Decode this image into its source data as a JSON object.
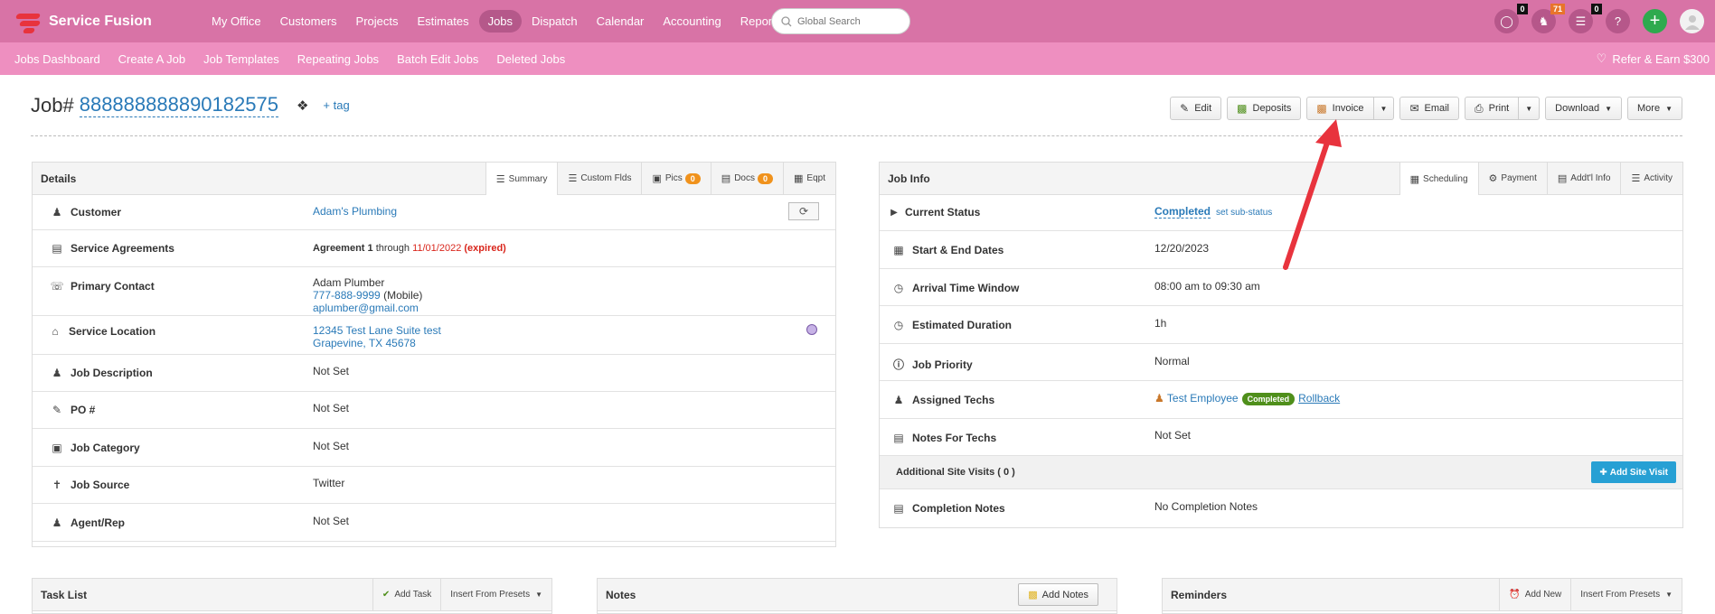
{
  "brand": {
    "name": "Service Fusion"
  },
  "main_menu": [
    "My Office",
    "Customers",
    "Projects",
    "Estimates",
    "Jobs",
    "Dispatch",
    "Calendar",
    "Accounting",
    "Reports"
  ],
  "search": {
    "placeholder": "Global Search"
  },
  "top_icons": {
    "chat_badge": "0",
    "notify_badge": "71",
    "tasks_badge": "0"
  },
  "sub_menu": [
    "Jobs Dashboard",
    "Create A Job",
    "Job Templates",
    "Repeating Jobs",
    "Batch Edit Jobs",
    "Deleted Jobs"
  ],
  "refer": "Refer & Earn $300",
  "job": {
    "label": "Job#",
    "number": "888888888890182575",
    "add_tag": "+ tag"
  },
  "actions": {
    "edit": "Edit",
    "deposits": "Deposits",
    "invoice": "Invoice",
    "email": "Email",
    "print": "Print",
    "download": "Download",
    "more": "More"
  },
  "details": {
    "title": "Details",
    "tabs": {
      "summary": "Summary",
      "custom": "Custom Flds",
      "pics": "Pics",
      "pics_count": "0",
      "docs": "Docs",
      "docs_count": "0",
      "eqpt": "Eqpt"
    },
    "customer": {
      "label": "Customer",
      "value": "Adam's Plumbing"
    },
    "agreements": {
      "label": "Service Agreements",
      "name": "Agreement 1",
      "through": "through",
      "date": "11/01/2022",
      "expired": "(expired)"
    },
    "contact": {
      "label": "Primary Contact",
      "name": "Adam Plumber",
      "phone": "777-888-9999",
      "phone_type": "(Mobile)",
      "email": "aplumber@gmail.com"
    },
    "location": {
      "label": "Service Location",
      "line1": "12345 Test Lane Suite test",
      "line2": "Grapevine, TX 45678"
    },
    "description": {
      "label": "Job Description",
      "value": "Not Set"
    },
    "po": {
      "label": "PO #",
      "value": "Not Set"
    },
    "category": {
      "label": "Job Category",
      "value": "Not Set"
    },
    "source": {
      "label": "Job Source",
      "value": "Twitter"
    },
    "agent": {
      "label": "Agent/Rep",
      "value": "Not Set"
    }
  },
  "jobinfo": {
    "title": "Job Info",
    "tabs": {
      "scheduling": "Scheduling",
      "payment": "Payment",
      "addtl": "Addt'l Info",
      "activity": "Activity"
    },
    "status": {
      "label": "Current Status",
      "value": "Completed",
      "sub": "set sub-status"
    },
    "dates": {
      "label": "Start & End Dates",
      "value": "12/20/2023"
    },
    "arrival": {
      "label": "Arrival Time Window",
      "value": "08:00 am to 09:30 am"
    },
    "duration": {
      "label": "Estimated Duration",
      "value": "1h"
    },
    "priority": {
      "label": "Job Priority",
      "value": "Normal"
    },
    "techs": {
      "label": "Assigned Techs",
      "name": "Test Employee",
      "status": "Completed",
      "rollback": "Rollback"
    },
    "notes_techs": {
      "label": "Notes For Techs",
      "value": "Not Set"
    },
    "site_visits": {
      "label": "Additional Site Visits ( 0 )",
      "button": "Add Site Visit"
    },
    "completion": {
      "label": "Completion Notes",
      "value": "No Completion Notes"
    }
  },
  "tasklist": {
    "title": "Task List",
    "add": "Add Task",
    "presets": "Insert From Presets"
  },
  "notes": {
    "title": "Notes",
    "add": "Add Notes"
  },
  "reminders": {
    "title": "Reminders",
    "add": "Add New",
    "presets": "Insert From Presets"
  },
  "colors": {
    "nav": "#d873a6",
    "subnav": "#ee8fc0",
    "link": "#2a7ab8",
    "arrow": "#e8333d"
  }
}
